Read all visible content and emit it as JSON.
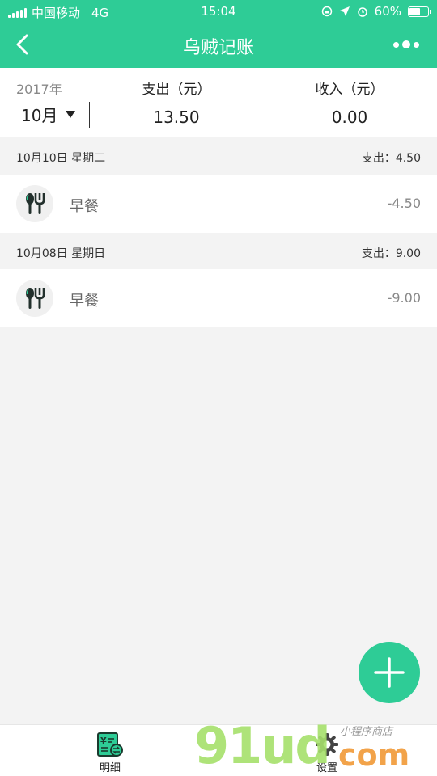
{
  "status_bar": {
    "carrier": "中国移动",
    "network": "4G",
    "time": "15:04",
    "battery": "60%",
    "battery_level": 0.6
  },
  "nav": {
    "title": "乌贼记账",
    "back_icon": "chevron-left-icon",
    "more_icon": "more-dots-icon"
  },
  "summary": {
    "year": "2017年",
    "month": "10月",
    "expense_label": "支出（元）",
    "expense_value": "13.50",
    "income_label": "收入（元）",
    "income_value": "0.00"
  },
  "days": [
    {
      "date": "10月10日 星期二",
      "total": "支出：4.50",
      "records": [
        {
          "category": "早餐",
          "amount": "-4.50",
          "icon": "utensils-icon"
        }
      ]
    },
    {
      "date": "10月08日 星期日",
      "total": "支出：9.00",
      "records": [
        {
          "category": "早餐",
          "amount": "-9.00",
          "icon": "utensils-icon"
        }
      ]
    }
  ],
  "tabs": [
    {
      "label": "明细",
      "icon": "ledger-icon"
    },
    {
      "label": "设置",
      "icon": "gear-icon"
    }
  ],
  "watermark": {
    "main": "91ud",
    "suffix": "com",
    "sub": "小程序商店"
  },
  "colors": {
    "accent": "#2ecc96",
    "background": "#f3f3f3"
  }
}
